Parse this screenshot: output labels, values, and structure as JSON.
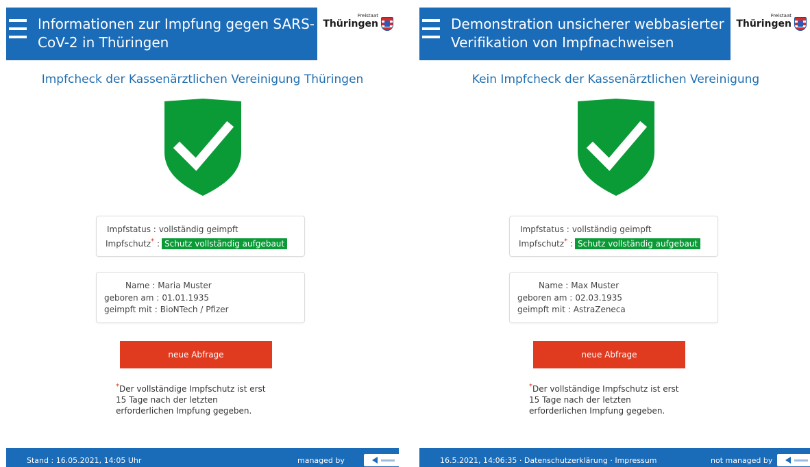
{
  "left": {
    "header": {
      "title": "Informationen zur Impfung gegen SARS-CoV-2 in Thüringen",
      "brand_small": "Freistaat",
      "brand_big": "Thüringen"
    },
    "subtitle": "Impfcheck der Kassenärztlichen Vereinigung Thüringen",
    "status": {
      "impfstatus_label": "Impfstatus :",
      "impfstatus_value": "vollständig geimpft",
      "impfschutz_label": "Impfschutz",
      "impfschutz_colon": " :",
      "impfschutz_value": "Schutz vollständig aufgebaut"
    },
    "person": {
      "name_label": "Name :",
      "name_value": "Maria Muster",
      "born_label": "geboren am :",
      "born_value": "01.01.1935",
      "vacc_label": "geimpft mit :",
      "vacc_value": "BioNTech / Pfizer"
    },
    "button": "neue Abfrage",
    "note": {
      "line1": "Der vollständige Impfschutz ist erst",
      "line2": "15 Tage nach der letzten",
      "line3": "erforderlichen Impfung gegeben."
    },
    "footer": {
      "text": "Stand : 16.05.2021, 14:05 Uhr",
      "managed": "managed by"
    }
  },
  "right": {
    "header": {
      "title": "Demonstration unsicherer webbasierter Verifikation von Impfnachweisen",
      "brand_small": "Freistaat",
      "brand_big": "Thüringen"
    },
    "subtitle": "Kein Impfcheck der Kassenärztlichen Vereinigung",
    "status": {
      "impfstatus_label": "Impfstatus :",
      "impfstatus_value": "vollständig geimpft",
      "impfschutz_label": "Impfschutz",
      "impfschutz_colon": " :",
      "impfschutz_value": "Schutz vollständig aufgebaut"
    },
    "person": {
      "name_label": "Name :",
      "name_value": "Max Muster",
      "born_label": "geboren am :",
      "born_value": "02.03.1935",
      "vacc_label": "geimpft mit :",
      "vacc_value": "AstraZeneca"
    },
    "button": "neue Abfrage",
    "note": {
      "line1": "Der vollständige Impfschutz ist erst",
      "line2": "15 Tage nach der letzten",
      "line3": "erforderlichen Impfung gegeben."
    },
    "footer": {
      "text": "16.5.2021, 14:06:35 · Datenschutzerklärung · Impressum",
      "managed": "not managed by"
    }
  },
  "colors": {
    "header_blue": "#1a6bb8",
    "shield_green": "#0a9a36",
    "button_red": "#e03a1f",
    "subtitle_blue": "#1f6eb0"
  }
}
